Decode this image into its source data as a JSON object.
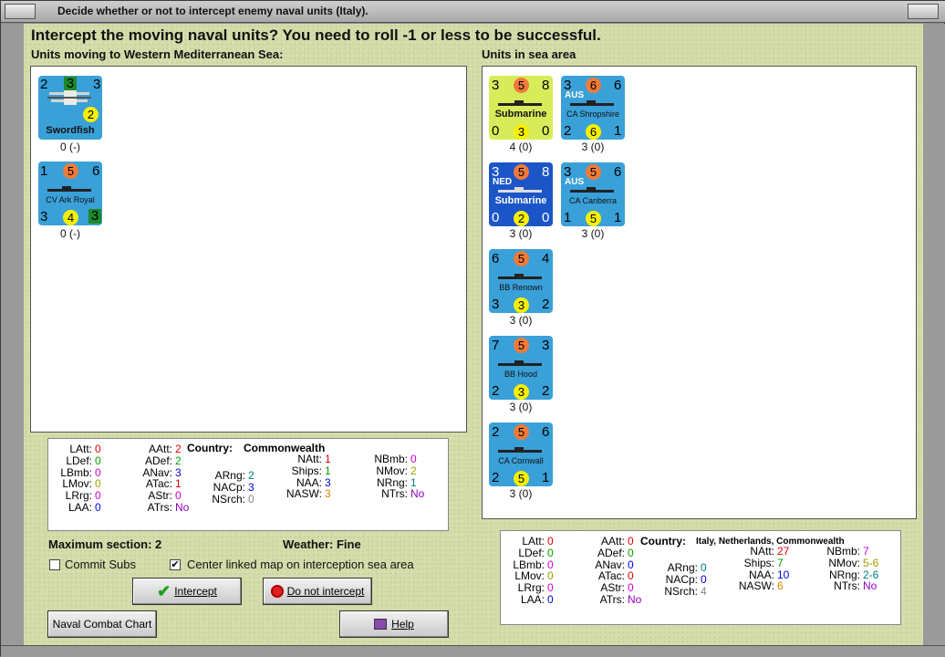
{
  "window": {
    "title": "Decide whether or not to intercept enemy naval units (Italy)."
  },
  "header": "Intercept the moving naval units?  You need to roll -1 or less to be successful.",
  "left_panel_label": "Units moving to Western Mediterranean Sea:",
  "right_panel_label": "Units in sea area",
  "moving_units": [
    {
      "name": "Swordfish",
      "tl": "2",
      "tm": "3",
      "tr": "3",
      "circle": "2",
      "label": "0 (-)",
      "type": "aircraft"
    },
    {
      "name": "CV Ark Royal",
      "tl": "1",
      "tm": "5",
      "tr": "6",
      "bl": "3",
      "bm": "4",
      "br": "3",
      "label": "0 (-)",
      "type": "ship"
    }
  ],
  "sea_units": [
    {
      "name": "Submarine",
      "tl": "3",
      "tm": "5",
      "tr": "8",
      "bl": "0",
      "bm": "3",
      "br": "0",
      "label": "4 (0)",
      "flag": "",
      "style": "yellow"
    },
    {
      "name": "CA Shropshire",
      "tl": "3",
      "tm": "6",
      "tr": "6",
      "bl": "2",
      "bm": "6",
      "br": "1",
      "label": "3 (0)",
      "flag": "AUS",
      "style": "blue"
    },
    {
      "name": "Submarine",
      "tl": "3",
      "tm": "5",
      "tr": "8",
      "bl": "0",
      "bm": "2",
      "br": "0",
      "label": "3 (0)",
      "flag": "NED",
      "style": "dark"
    },
    {
      "name": "CA Canberra",
      "tl": "3",
      "tm": "5",
      "tr": "6",
      "bl": "1",
      "bm": "5",
      "br": "1",
      "label": "3 (0)",
      "flag": "AUS",
      "style": "blue"
    },
    {
      "name": "BB Renown",
      "tl": "6",
      "tm": "5",
      "tr": "4",
      "bl": "3",
      "bm": "3",
      "br": "2",
      "label": "3 (0)",
      "flag": "",
      "style": "blue"
    },
    {
      "name": "BB Hood",
      "tl": "7",
      "tm": "5",
      "tr": "3",
      "bl": "2",
      "bm": "3",
      "br": "2",
      "label": "3 (0)",
      "flag": "",
      "style": "blue"
    },
    {
      "name": "CA Cornwall",
      "tl": "2",
      "tm": "5",
      "tr": "6",
      "bl": "2",
      "bm": "5",
      "br": "1",
      "label": "3 (0)",
      "flag": "",
      "style": "blue"
    }
  ],
  "left_stats": {
    "country_label": "Country:",
    "country": "Commonwealth",
    "items": [
      {
        "k": "LAtt:",
        "v": "0",
        "c": "#e00000"
      },
      {
        "k": "LDef:",
        "v": "0",
        "c": "#00a000"
      },
      {
        "k": "LBmb:",
        "v": "0",
        "c": "#d000d0"
      },
      {
        "k": "LMov:",
        "v": "0",
        "c": "#a0a000"
      },
      {
        "k": "LRrg:",
        "v": "0",
        "c": "#d000d0"
      },
      {
        "k": "LAA:",
        "v": "0",
        "c": "#0000e0"
      },
      {
        "k": "AAtt:",
        "v": "2",
        "c": "#e00000"
      },
      {
        "k": "ADef:",
        "v": "2",
        "c": "#00a000"
      },
      {
        "k": "ANav:",
        "v": "3",
        "c": "#0000e0"
      },
      {
        "k": "ATac:",
        "v": "1",
        "c": "#e00000"
      },
      {
        "k": "AStr:",
        "v": "0",
        "c": "#d000d0"
      },
      {
        "k": "ATrs:",
        "v": "No",
        "c": "#9000c0"
      },
      {
        "k": "ARng:",
        "v": "2",
        "c": "#008080"
      },
      {
        "k": "NACp:",
        "v": "3",
        "c": "#0000e0"
      },
      {
        "k": "NSrch:",
        "v": "0",
        "c": "#888888"
      },
      {
        "k": "NAtt:",
        "v": "1",
        "c": "#e00000"
      },
      {
        "k": "Ships:",
        "v": "1",
        "c": "#00a000"
      },
      {
        "k": "NAA:",
        "v": "3",
        "c": "#0000e0"
      },
      {
        "k": "NASW:",
        "v": "3",
        "c": "#e08000"
      },
      {
        "k": "NBmb:",
        "v": "0",
        "c": "#d000d0"
      },
      {
        "k": "NMov:",
        "v": "2",
        "c": "#a0a000"
      },
      {
        "k": "NRng:",
        "v": "1",
        "c": "#008080"
      },
      {
        "k": "NTrs:",
        "v": "No",
        "c": "#9000c0"
      }
    ]
  },
  "right_stats": {
    "country_label": "Country:",
    "country": "Italy, Netherlands, Commonwealth",
    "items": [
      {
        "k": "LAtt:",
        "v": "0",
        "c": "#e00000"
      },
      {
        "k": "LDef:",
        "v": "0",
        "c": "#00a000"
      },
      {
        "k": "LBmb:",
        "v": "0",
        "c": "#d000d0"
      },
      {
        "k": "LMov:",
        "v": "0",
        "c": "#a0a000"
      },
      {
        "k": "LRrg:",
        "v": "0",
        "c": "#d000d0"
      },
      {
        "k": "LAA:",
        "v": "0",
        "c": "#0000e0"
      },
      {
        "k": "AAtt:",
        "v": "0",
        "c": "#e00000"
      },
      {
        "k": "ADef:",
        "v": "0",
        "c": "#00a000"
      },
      {
        "k": "ANav:",
        "v": "0",
        "c": "#0000e0"
      },
      {
        "k": "ATac:",
        "v": "0",
        "c": "#e00000"
      },
      {
        "k": "AStr:",
        "v": "0",
        "c": "#d000d0"
      },
      {
        "k": "ATrs:",
        "v": "No",
        "c": "#9000c0"
      },
      {
        "k": "ARng:",
        "v": "0",
        "c": "#008080"
      },
      {
        "k": "NACp:",
        "v": "0",
        "c": "#0000e0"
      },
      {
        "k": "NSrch:",
        "v": "4",
        "c": "#888888"
      },
      {
        "k": "NAtt:",
        "v": "27",
        "c": "#e00000"
      },
      {
        "k": "Ships:",
        "v": "7",
        "c": "#00a000"
      },
      {
        "k": "NAA:",
        "v": "10",
        "c": "#0000e0"
      },
      {
        "k": "NASW:",
        "v": "6",
        "c": "#e08000"
      },
      {
        "k": "NBmb:",
        "v": "7",
        "c": "#d000d0"
      },
      {
        "k": "NMov:",
        "v": "5-6",
        "c": "#a0a000"
      },
      {
        "k": "NRng:",
        "v": "2-6",
        "c": "#008080"
      },
      {
        "k": "NTrs:",
        "v": "No",
        "c": "#9000c0"
      }
    ]
  },
  "maximum_section": "Maximum section: 2",
  "weather": "Weather:  Fine",
  "commit_subs": {
    "label": "Commit Subs",
    "checked": false
  },
  "center_map": {
    "label": "Center linked map on interception sea area",
    "checked": true
  },
  "buttons": {
    "intercept": "Intercept",
    "do_not_intercept": "Do not intercept",
    "naval_combat_chart": "Naval Combat Chart",
    "help": "Help"
  }
}
